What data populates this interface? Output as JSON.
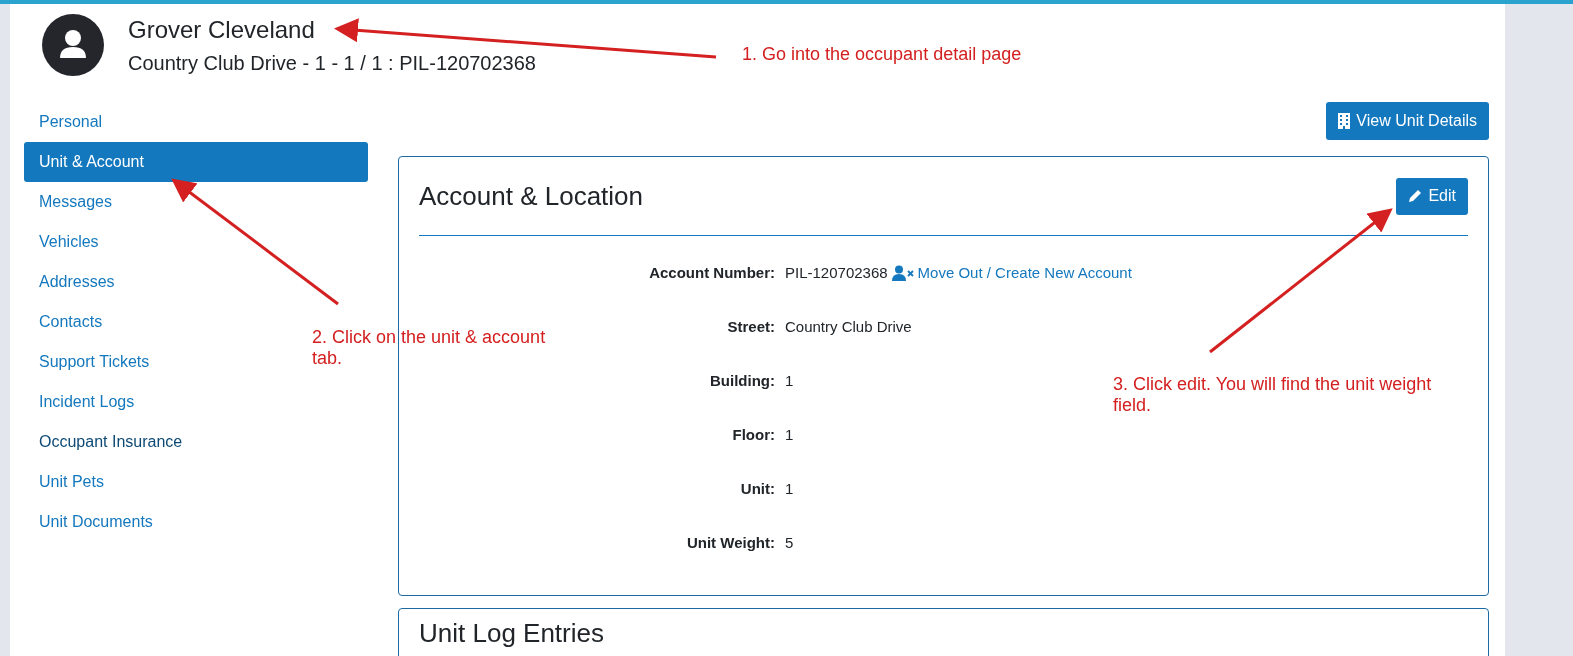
{
  "header": {
    "name": "Grover Cleveland",
    "subtitle": "Country Club Drive - 1 - 1 / 1 : PIL-120702368"
  },
  "sidebar": {
    "items": [
      {
        "label": "Personal",
        "selected": false,
        "hovered": false
      },
      {
        "label": "Unit & Account",
        "selected": true,
        "hovered": false
      },
      {
        "label": "Messages",
        "selected": false,
        "hovered": false
      },
      {
        "label": "Vehicles",
        "selected": false,
        "hovered": false
      },
      {
        "label": "Addresses",
        "selected": false,
        "hovered": false
      },
      {
        "label": "Contacts",
        "selected": false,
        "hovered": false
      },
      {
        "label": "Support Tickets",
        "selected": false,
        "hovered": false
      },
      {
        "label": "Incident Logs",
        "selected": false,
        "hovered": false
      },
      {
        "label": "Occupant Insurance",
        "selected": false,
        "hovered": true
      },
      {
        "label": "Unit Pets",
        "selected": false,
        "hovered": false
      },
      {
        "label": "Unit Documents",
        "selected": false,
        "hovered": false
      }
    ]
  },
  "view_unit_button": "View Unit Details",
  "account_card": {
    "title": "Account & Location",
    "edit_button": "Edit",
    "fields": [
      {
        "label": "Account Number:",
        "value": "PIL-120702368",
        "link": "Move Out / Create New Account"
      },
      {
        "label": "Street:",
        "value": "Country Club Drive"
      },
      {
        "label": "Building:",
        "value": "1"
      },
      {
        "label": "Floor:",
        "value": "1"
      },
      {
        "label": "Unit:",
        "value": "1"
      },
      {
        "label": "Unit Weight:",
        "value": "5"
      }
    ]
  },
  "log_card": {
    "title": "Unit Log Entries"
  },
  "annotations": [
    {
      "text": "1. Go into the occupant detail page"
    },
    {
      "text": "2. Click on the unit & account tab."
    },
    {
      "text": "3. Click edit. You will find the unit weight field."
    }
  ]
}
